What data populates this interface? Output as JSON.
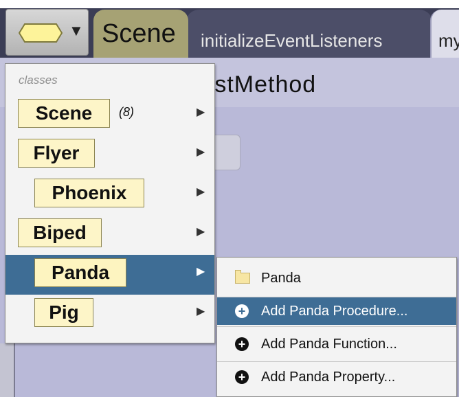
{
  "tabs": {
    "scene": "Scene",
    "init": "initializeEventListeners",
    "my": "my"
  },
  "editor": {
    "method_title": "rstMethod"
  },
  "menu": {
    "heading": "classes",
    "items": [
      {
        "label": "Scene",
        "count": "(8)"
      },
      {
        "label": "Flyer"
      },
      {
        "label": "Phoenix"
      },
      {
        "label": "Biped"
      },
      {
        "label": "Panda",
        "selected": true
      },
      {
        "label": "Pig"
      }
    ]
  },
  "submenu": {
    "items": [
      {
        "label": "Panda",
        "icon": "folder-icon"
      },
      {
        "label": "Add Panda Procedure...",
        "icon": "plus-circle-icon",
        "selected": true
      },
      {
        "label": "Add Panda Function...",
        "icon": "plus-circle-icon"
      },
      {
        "label": "Add Panda Property...",
        "icon": "plus-circle-icon"
      }
    ]
  },
  "colors": {
    "selection": "#3e6d95",
    "class_tile": "#fdf5c8",
    "scene_tab": "#a6a274"
  }
}
